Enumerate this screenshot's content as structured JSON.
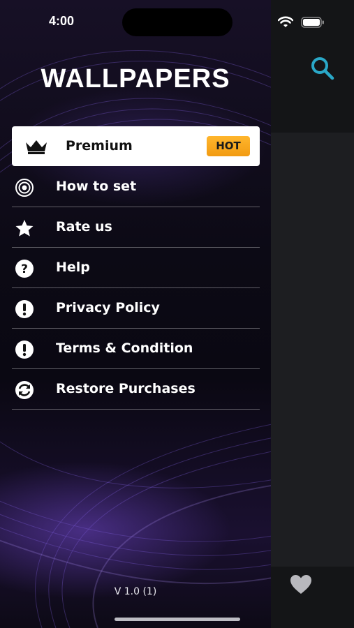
{
  "status_bar": {
    "time": "4:00"
  },
  "drawer": {
    "title": "WALLPAPERS",
    "premium": {
      "label": "Premium",
      "badge": "HOT",
      "badge_color": "#f5a41c"
    },
    "items": [
      {
        "label": "How to set",
        "icon": "target-icon"
      },
      {
        "label": "Rate us",
        "icon": "star-icon"
      },
      {
        "label": "Help",
        "icon": "question-icon"
      },
      {
        "label": "Privacy Policy",
        "icon": "alert-icon"
      },
      {
        "label": "Terms & Condition",
        "icon": "alert-icon"
      },
      {
        "label": "Restore Purchases",
        "icon": "restore-icon"
      }
    ],
    "version": "V 1.0 (1)"
  },
  "colors": {
    "accent": "#2aa8c8",
    "drawer_bg": "#0c0a15",
    "panel_bg": "#1d1e21"
  }
}
